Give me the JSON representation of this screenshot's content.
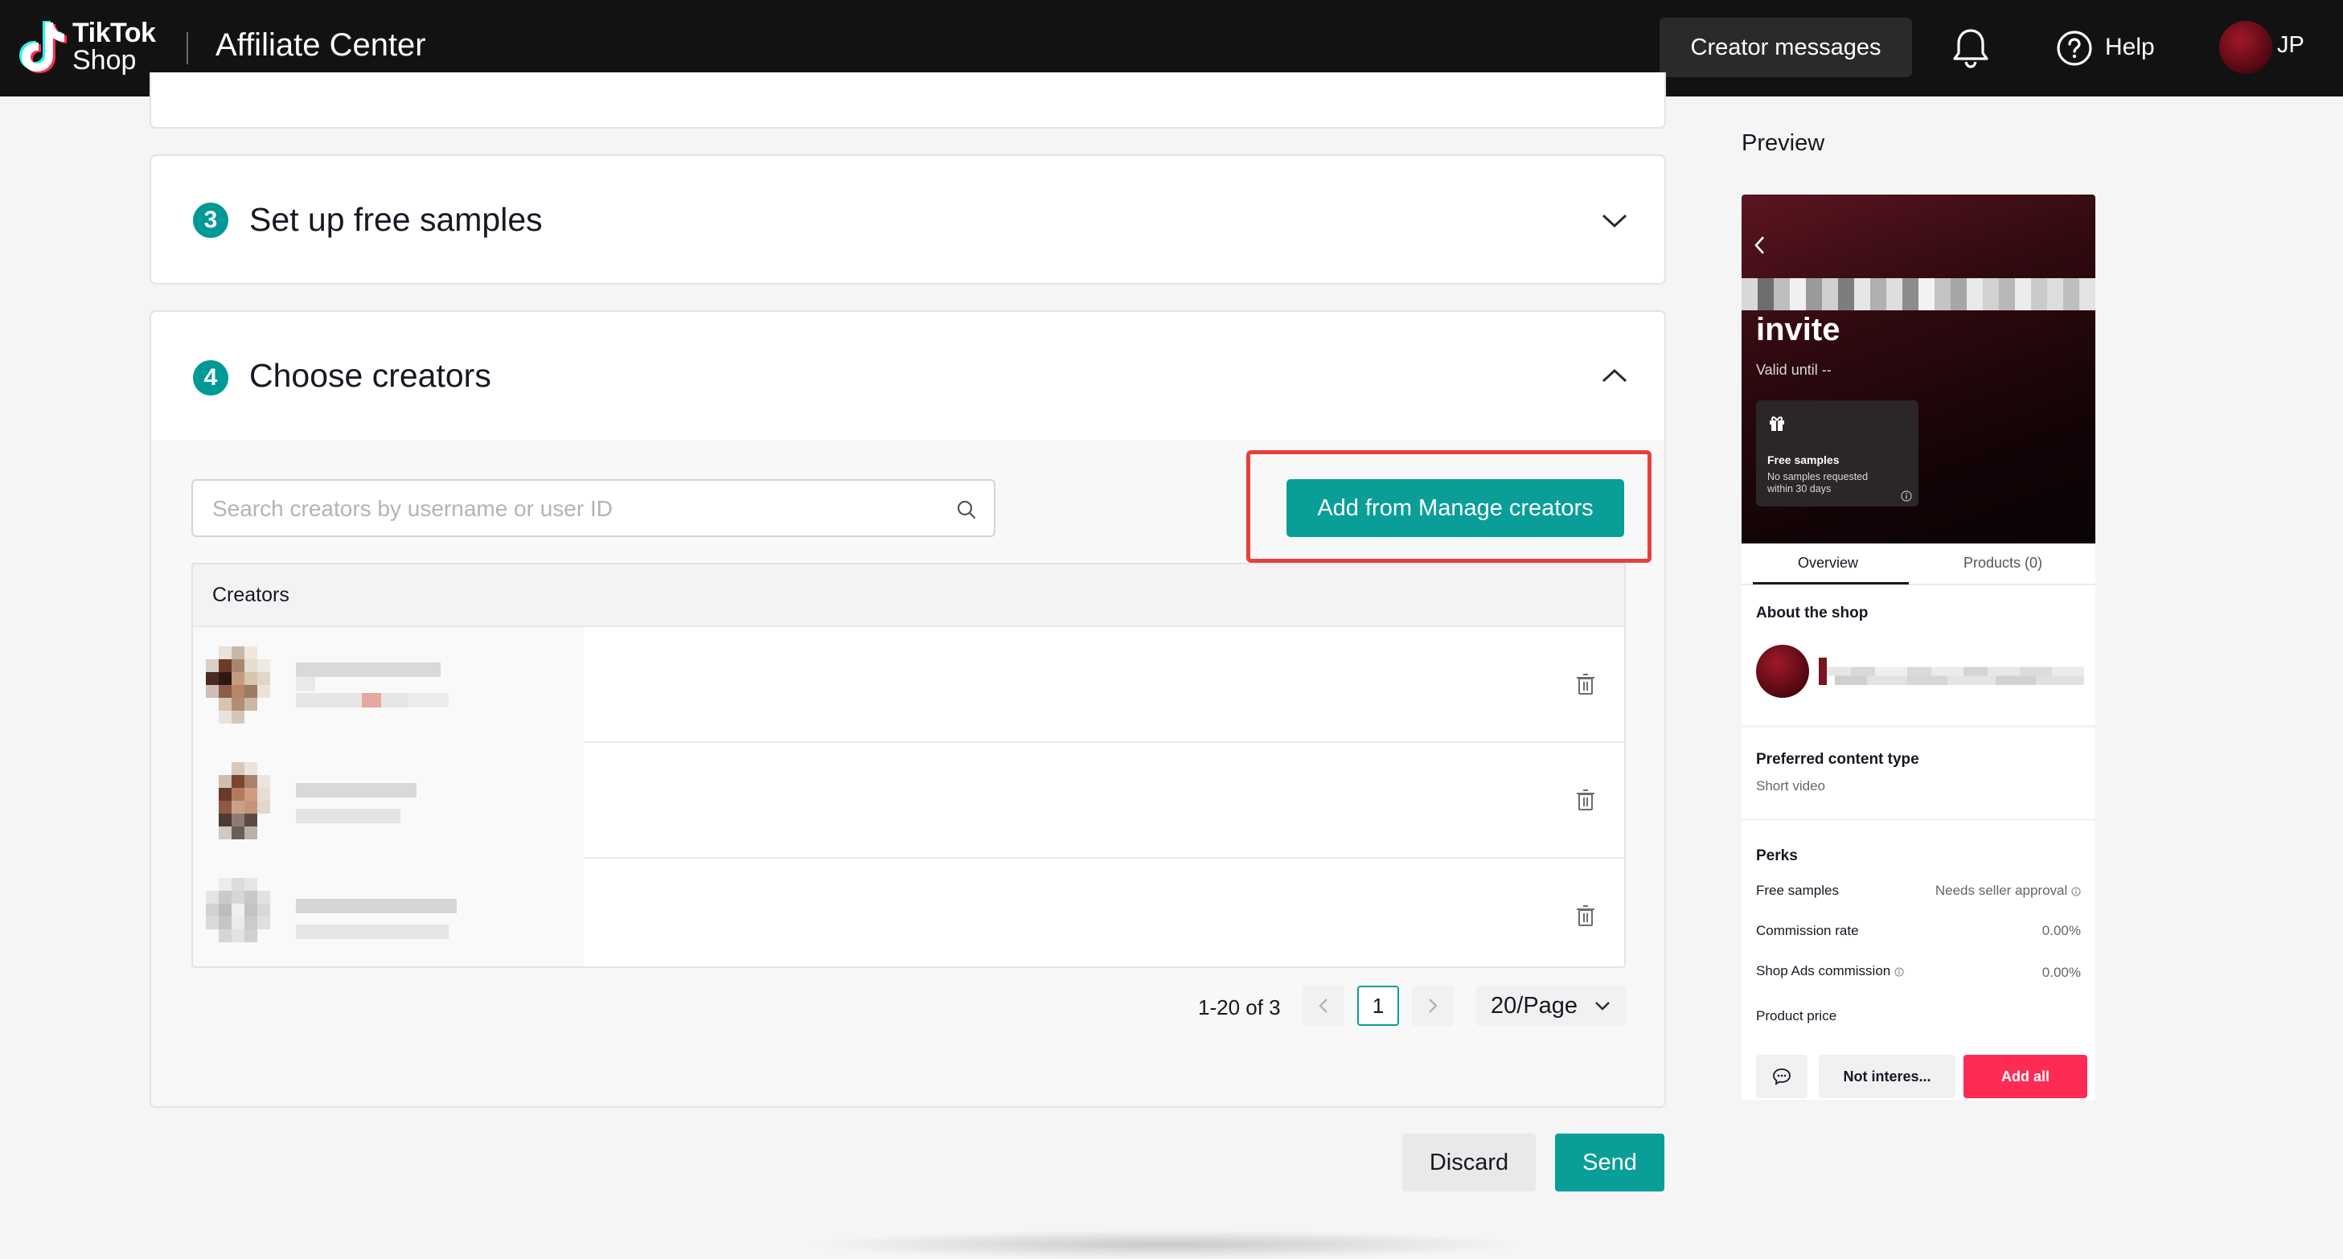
{
  "header": {
    "logo_line1": "TikTok",
    "logo_line2": "Shop",
    "title": "Affiliate Center",
    "creator_messages_label": "Creator messages",
    "help_label": "Help",
    "user_initials": "JP"
  },
  "steps": {
    "free_samples": {
      "number": "3",
      "title": "Set up free samples",
      "expanded": false
    },
    "choose_creators": {
      "number": "4",
      "title": "Choose creators",
      "expanded": true
    }
  },
  "creators_section": {
    "search_placeholder": "Search creators by username or user ID",
    "search_value": "",
    "add_button_label": "Add from Manage creators",
    "table_header": "Creators",
    "rows_count_visible": 3
  },
  "pagination": {
    "range_text": "1-20 of 3",
    "current_page": "1",
    "page_size": "20/Page"
  },
  "footer_buttons": {
    "discard": "Discard",
    "send": "Send"
  },
  "preview": {
    "label": "Preview",
    "invite_title": "invite",
    "valid_until": "Valid until --",
    "sample_card_title": "Free samples",
    "sample_card_sub": "No samples requested within 30 days",
    "tabs": [
      "Overview",
      "Products (0)"
    ],
    "about_title": "About the shop",
    "content_type_title": "Preferred content type",
    "content_type_value": "Short video",
    "perks_title": "Perks",
    "perks": [
      {
        "label": "Free samples",
        "value": "Needs seller approval"
      },
      {
        "label": "Commission rate",
        "value": "0.00%"
      },
      {
        "label": "Shop Ads commission",
        "value": "0.00%"
      },
      {
        "label": "Product price",
        "value": ""
      }
    ],
    "not_interested_label": "Not interes...",
    "add_all_label": "Add all"
  },
  "colors": {
    "teal_accent": "#0a9e98",
    "highlight_red": "#e5413a",
    "tiktok_pink": "#fe2c55",
    "topbar_bg": "#121212"
  },
  "icons": [
    "tiktok-logo-icon",
    "bell-icon",
    "help-icon",
    "chevron-down-icon",
    "chevron-up-icon",
    "search-icon",
    "trash-icon",
    "chevron-left-icon",
    "chevron-right-icon",
    "gift-icon",
    "chat-icon",
    "info-icon"
  ]
}
